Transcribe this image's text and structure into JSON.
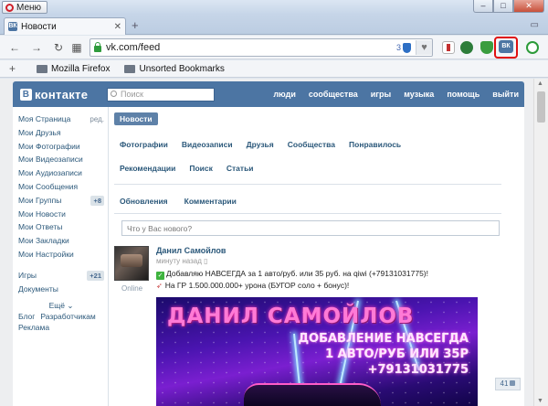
{
  "browser": {
    "menu_label": "Меню",
    "tab_title": "Новости",
    "tab_favicon": "ВК",
    "new_tab": "+",
    "url": "vk.com/feed",
    "url_badge": "3",
    "bookmarks": [
      "Mozilla Firefox",
      "Unsorted Bookmarks"
    ],
    "extension_label": "ВК",
    "accent_highlight": "#e01010"
  },
  "vk": {
    "logo": "контакте",
    "logo_letter": "В",
    "search_placeholder": "Поиск",
    "top_nav": [
      "люди",
      "сообщества",
      "игры",
      "музыка",
      "помощь",
      "выйти"
    ],
    "brand_color": "#4c75a3",
    "left_menu": [
      {
        "label": "Моя Страница",
        "extra": "ред."
      },
      {
        "label": "Мои Друзья"
      },
      {
        "label": "Мои Фотографии"
      },
      {
        "label": "Мои Видеозаписи"
      },
      {
        "label": "Мои Аудиозаписи"
      },
      {
        "label": "Мои Сообщения"
      },
      {
        "label": "Мои Группы",
        "count": "+8"
      },
      {
        "label": "Мои Новости"
      },
      {
        "label": "Мои Ответы"
      },
      {
        "label": "Мои Закладки"
      },
      {
        "label": "Мои Настройки"
      }
    ],
    "left_menu_2": [
      {
        "label": "Игры",
        "count": "+21"
      },
      {
        "label": "Документы"
      }
    ],
    "more_label": "Ещё ⌄",
    "footer_links": [
      "Блог",
      "Разработчикам",
      "Реклама"
    ],
    "news_tab": "Новости",
    "filters_row1": [
      "Фотографии",
      "Видеозаписи",
      "Друзья",
      "Сообщества",
      "Понравилось"
    ],
    "filters_row2": [
      "Рекомендации",
      "Поиск",
      "Статьи"
    ],
    "feed_tabs": [
      "Обновления",
      "Комментарии"
    ],
    "composer_placeholder": "Что у Вас нового?",
    "post": {
      "author": "Данил Самойлов",
      "time": "минуту назад",
      "online": "Online",
      "line1": "Добавляю НАВСЕГДА за 1 авто/руб. или 35 руб. на qiwi (+79131031775)!",
      "line2": "На ГР 1.500.000.000+ урона (БУГОР соло + бонус)!",
      "banner_title": "ДАНИЛ САМОЙЛОВ",
      "banner_promo": [
        "ДОБАВЛЕНИЕ НАВСЕГДА",
        "1 АВТО/РУБ ИЛИ 35Р",
        "+79131031775"
      ]
    },
    "likes_count": "41"
  }
}
